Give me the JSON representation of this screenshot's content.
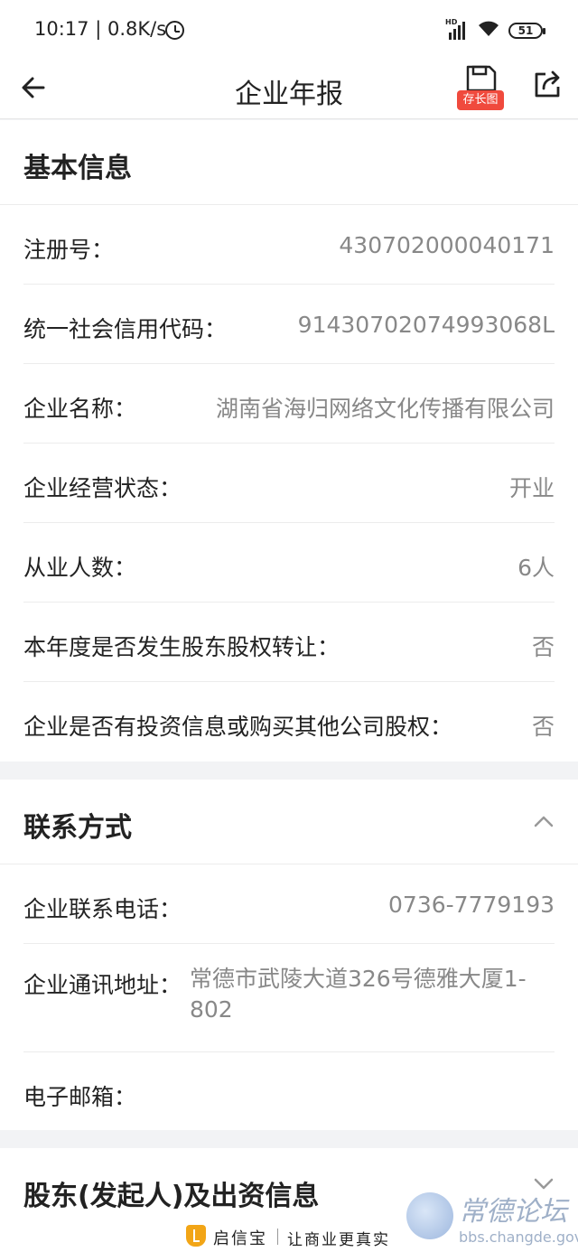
{
  "status": {
    "time": "10:17",
    "speed": "0.8K/s",
    "battery": "51",
    "signal_badge": "HD"
  },
  "nav": {
    "title": "企业年报",
    "save_label": "存长图"
  },
  "basic": {
    "title": "基本信息",
    "rows": [
      {
        "label": "注册号：",
        "value": "430702000040171"
      },
      {
        "label": "统一社会信用代码：",
        "value": "91430702074993068L"
      },
      {
        "label": "企业名称：",
        "value": "湖南省海归网络文化传播有限公司"
      },
      {
        "label": "企业经营状态：",
        "value": "开业"
      },
      {
        "label": "从业人数：",
        "value": "6人"
      },
      {
        "label": "本年度是否发生股东股权转让：",
        "value": "否"
      },
      {
        "label": "企业是否有投资信息或购买其他公司股权：",
        "value": "否"
      }
    ]
  },
  "contact": {
    "title": "联系方式",
    "phone_label": "企业联系电话：",
    "phone_value": "0736-7779193",
    "address_label": "企业通讯地址：",
    "address_value": "常德市武陵大道326号德雅大厦1-802",
    "email_label": "电子邮箱：",
    "email_value": ""
  },
  "shareholders": {
    "title": "股东(发起人)及出资信息"
  },
  "footer": {
    "brand": "启信宝",
    "slogan": "让商业更真实"
  },
  "watermark": {
    "title": "常德论坛",
    "url": "bbs.changde.gov.cn"
  },
  "colors": {
    "accent_red": "#f04a3d",
    "brand_gold": "#f2a516"
  }
}
